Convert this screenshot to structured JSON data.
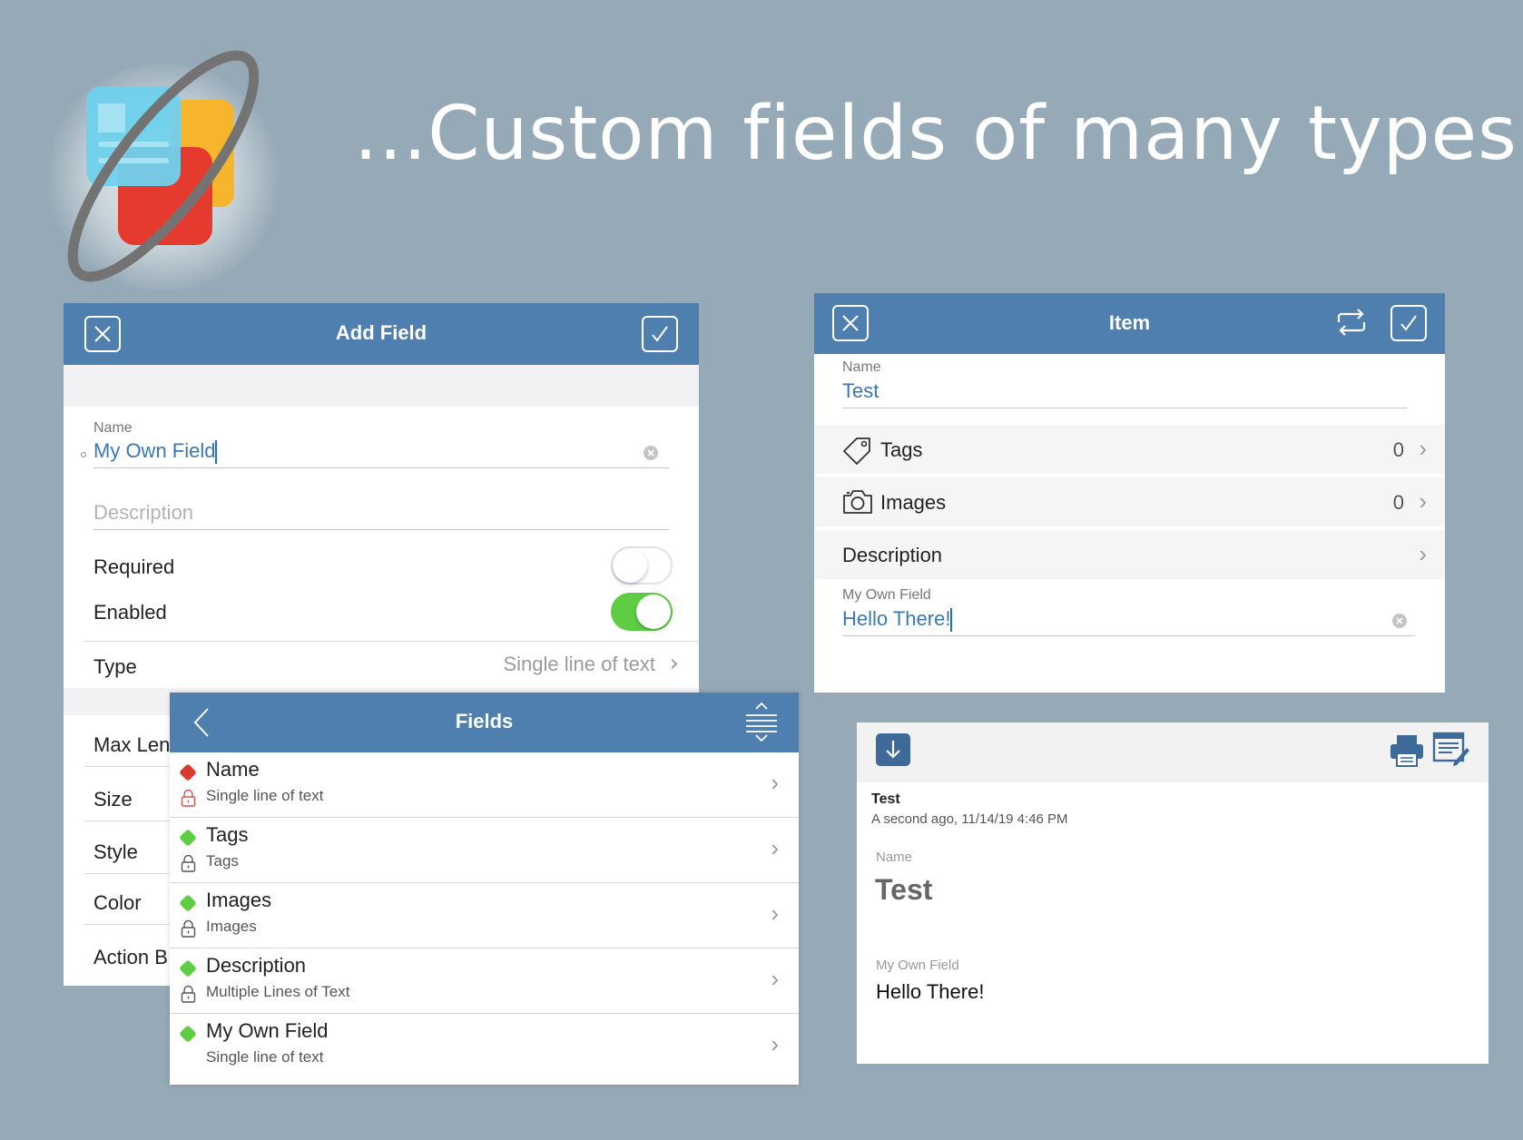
{
  "headline": "...Custom fields of many types",
  "add_field": {
    "title": "Add Field",
    "name_label": "Name",
    "name_value": "My Own Field",
    "description_placeholder": "Description",
    "required_label": "Required",
    "required_on": false,
    "enabled_label": "Enabled",
    "enabled_on": true,
    "type_label": "Type",
    "type_value": "Single line of text",
    "rows": [
      "Max Len",
      "Size",
      "Style",
      "Color",
      "Action B"
    ]
  },
  "fields": {
    "title": "Fields",
    "items": [
      {
        "title": "Name",
        "subtitle": "Single line of text",
        "status": "required",
        "color": "#d93a2f",
        "locked": true,
        "lock_color": "#d9534f"
      },
      {
        "title": "Tags",
        "subtitle": "Tags",
        "status": "enabled",
        "color": "#5fcd43",
        "locked": true,
        "lock_color": "#555555"
      },
      {
        "title": "Images",
        "subtitle": "Images",
        "status": "enabled",
        "color": "#5fcd43",
        "locked": true,
        "lock_color": "#555555"
      },
      {
        "title": "Description",
        "subtitle": "Multiple Lines of Text",
        "status": "enabled",
        "color": "#5fcd43",
        "locked": true,
        "lock_color": "#555555"
      },
      {
        "title": "My Own Field",
        "subtitle": "Single line of text",
        "status": "enabled",
        "color": "#5fcd43",
        "locked": false
      }
    ]
  },
  "item": {
    "title": "Item",
    "name_label": "Name",
    "name_value": "Test",
    "tags_label": "Tags",
    "tags_count": "0",
    "images_label": "Images",
    "images_count": "0",
    "description_label": "Description",
    "custom_label": "My Own Field",
    "custom_value": "Hello There!"
  },
  "detail": {
    "title": "Test",
    "timestamp": "A second ago, 11/14/19 4:46 PM",
    "name_label": "Name",
    "name_value": "Test",
    "custom_label": "My Own Field",
    "custom_value": "Hello There!"
  },
  "colors": {
    "background": "#95a9b6",
    "navbar": "#4f7fae",
    "accent_text": "#3a78b4",
    "toggle_on": "#5fcd43"
  },
  "icons": [
    "close-icon",
    "checkmark-icon",
    "back-icon",
    "reorder-icon",
    "sync-icon",
    "tag-icon",
    "camera-icon",
    "clear-icon",
    "lock-icon",
    "download-icon",
    "print-icon",
    "edit-icon"
  ]
}
